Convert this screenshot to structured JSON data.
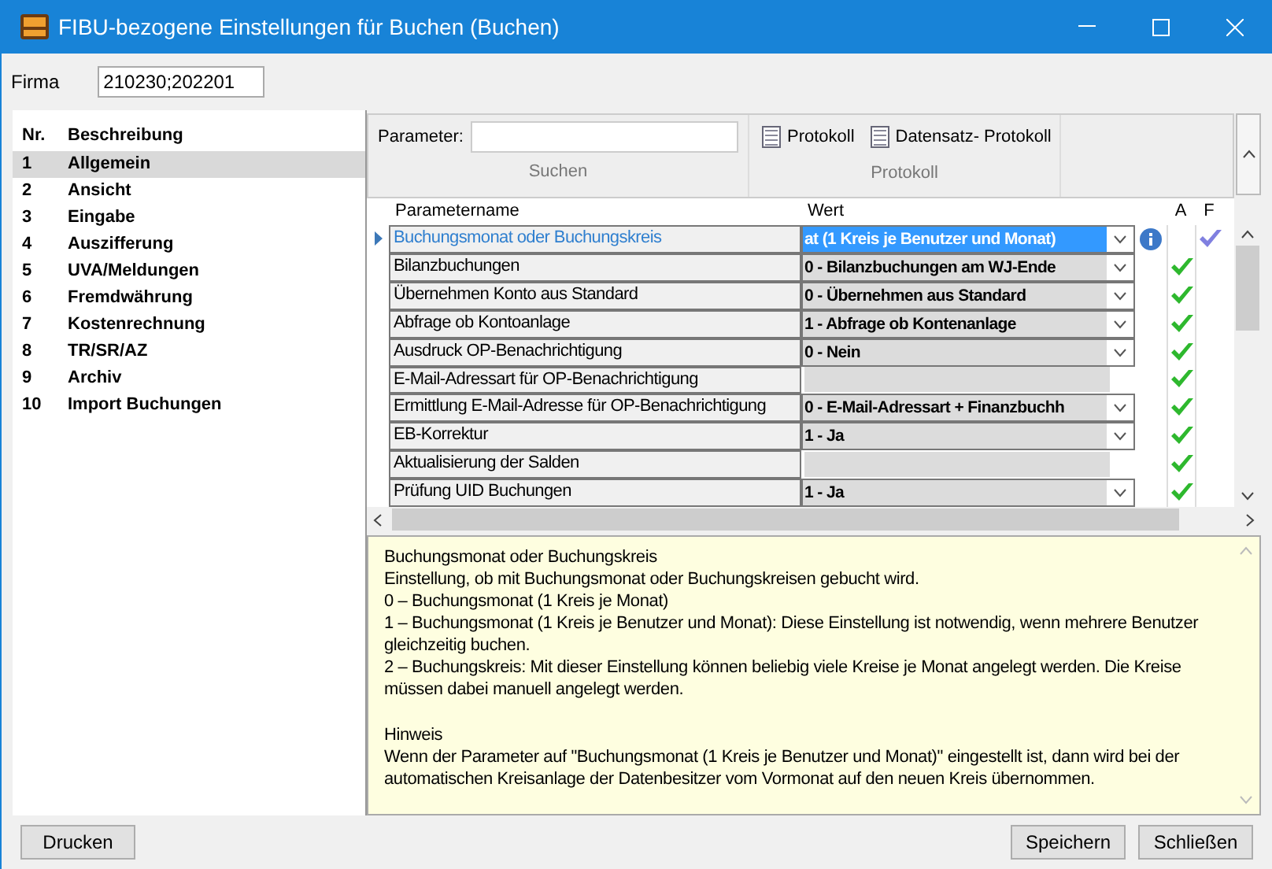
{
  "window": {
    "title": "FIBU-bezogene Einstellungen für Buchen (Buchen)"
  },
  "firma": {
    "label": "Firma",
    "value": "210230;202201"
  },
  "categories": {
    "columns": [
      "Nr.",
      "Beschreibung"
    ],
    "items": [
      {
        "nr": "1",
        "label": "Allgemein",
        "selected": true
      },
      {
        "nr": "2",
        "label": "Ansicht",
        "selected": false
      },
      {
        "nr": "3",
        "label": "Eingabe",
        "selected": false
      },
      {
        "nr": "4",
        "label": "Auszifferung",
        "selected": false
      },
      {
        "nr": "5",
        "label": "UVA/Meldungen",
        "selected": false
      },
      {
        "nr": "6",
        "label": "Fremdwährung",
        "selected": false
      },
      {
        "nr": "7",
        "label": "Kostenrechnung",
        "selected": false
      },
      {
        "nr": "8",
        "label": "TR/SR/AZ",
        "selected": false
      },
      {
        "nr": "9",
        "label": "Archiv",
        "selected": false
      },
      {
        "nr": "10",
        "label": "Import Buchungen",
        "selected": false
      }
    ]
  },
  "toolbar": {
    "search_label": "Parameter:",
    "search_group": "Suchen",
    "protocol_buttons": [
      "Protokoll",
      "Datensatz- Protokoll"
    ],
    "protocol_group": "Protokoll"
  },
  "grid": {
    "columns": [
      "Parametername",
      "Wert",
      "A",
      "F"
    ],
    "rows": [
      {
        "name": "Buchungsmonat oder Buchungskreis",
        "value": "at (1 Kreis je Benutzer und Monat)",
        "selected": true,
        "info": true,
        "a": false,
        "f": true
      },
      {
        "name": "Bilanzbuchungen",
        "value": "0 - Bilanzbuchungen am WJ-Ende",
        "selected": false,
        "info": false,
        "a": true,
        "f": false
      },
      {
        "name": "Übernehmen Konto aus Standard",
        "value": "0 - Übernehmen aus Standard",
        "selected": false,
        "info": false,
        "a": true,
        "f": false
      },
      {
        "name": "Abfrage ob Kontoanlage",
        "value": "1 - Abfrage ob Kontenanlage",
        "selected": false,
        "info": false,
        "a": true,
        "f": false
      },
      {
        "name": "Ausdruck OP-Benachrichtigung",
        "value": "0 - Nein",
        "selected": false,
        "info": false,
        "a": true,
        "f": false
      },
      {
        "name": "E-Mail-Adressart für OP-Benachrichtigung",
        "selected": false,
        "info": false,
        "a": true,
        "f": false
      },
      {
        "name": "Ermittlung E-Mail-Adresse für OP-Benachrichtigung",
        "value": "0 - E-Mail-Adressart + Finanzbuchh",
        "selected": false,
        "info": false,
        "a": true,
        "f": false
      },
      {
        "name": "EB-Korrektur",
        "value": "1 - Ja",
        "selected": false,
        "info": false,
        "a": true,
        "f": false
      },
      {
        "name": "Aktualisierung der Salden",
        "selected": false,
        "info": false,
        "a": true,
        "f": false
      },
      {
        "name": "Prüfung UID Buchungen",
        "value": "1 - Ja",
        "selected": false,
        "info": false,
        "a": true,
        "f": false
      }
    ]
  },
  "help": {
    "sections": [
      [
        "Buchungsmonat oder Buchungskreis",
        "Einstellung, ob mit Buchungsmonat oder Buchungskreisen gebucht wird.",
        "0 – Buchungsmonat (1 Kreis je Monat)",
        "1 – Buchungsmonat (1 Kreis je Benutzer und Monat): Diese Einstellung ist notwendig, wenn mehrere Benutzer gleichzeitig buchen.",
        "2 – Buchungskreis: Mit dieser Einstellung können beliebig viele Kreise je Monat angelegt werden. Die Kreise müssen dabei manuell angelegt werden."
      ],
      [
        "Hinweis",
        "Wenn der Parameter auf \"Buchungsmonat (1 Kreis je Benutzer und Monat)\" eingestellt ist, dann wird bei der automatischen Kreisanlage der Datenbesitzer vom Vormonat auf den neuen Kreis übernommen."
      ]
    ]
  },
  "buttons": {
    "left": [
      "Drucken"
    ],
    "right": [
      "Speichern",
      "Schließen"
    ]
  }
}
